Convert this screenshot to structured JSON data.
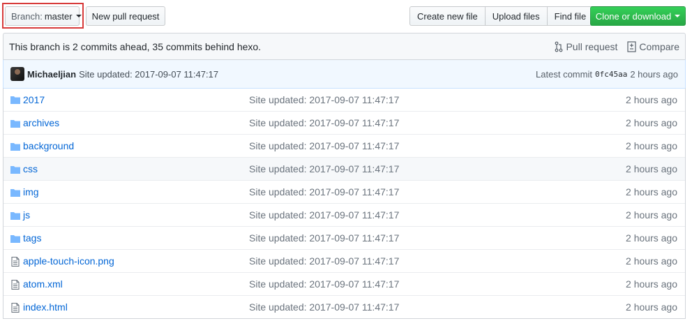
{
  "toolbar": {
    "branch_label": "Branch:",
    "branch_value": "master",
    "new_pull_request": "New pull request",
    "create_new_file": "Create new file",
    "upload_files": "Upload files",
    "find_file": "Find file",
    "clone_or_download": "Clone or download"
  },
  "info": {
    "branch_status": "This branch is 2 commits ahead, 35 commits behind hexo.",
    "pull_request": "Pull request",
    "compare": "Compare"
  },
  "latest_commit": {
    "author": "Michaeljian",
    "message": "Site updated: 2017-09-07 11:47:17",
    "prefix": "Latest commit",
    "sha": "0fc45aa",
    "age": "2 hours ago"
  },
  "files": [
    {
      "type": "folder-icon",
      "name": "2017",
      "message": "Site updated: 2017-09-07 11:47:17",
      "age": "2 hours ago"
    },
    {
      "type": "folder-icon",
      "name": "archives",
      "message": "Site updated: 2017-09-07 11:47:17",
      "age": "2 hours ago"
    },
    {
      "type": "folder-icon",
      "name": "background",
      "message": "Site updated: 2017-09-07 11:47:17",
      "age": "2 hours ago"
    },
    {
      "type": "folder-icon",
      "name": "css",
      "message": "Site updated: 2017-09-07 11:47:17",
      "age": "2 hours ago"
    },
    {
      "type": "folder-icon",
      "name": "img",
      "message": "Site updated: 2017-09-07 11:47:17",
      "age": "2 hours ago"
    },
    {
      "type": "folder-icon",
      "name": "js",
      "message": "Site updated: 2017-09-07 11:47:17",
      "age": "2 hours ago"
    },
    {
      "type": "folder-icon",
      "name": "tags",
      "message": "Site updated: 2017-09-07 11:47:17",
      "age": "2 hours ago"
    },
    {
      "type": "file-icon",
      "name": "apple-touch-icon.png",
      "message": "Site updated: 2017-09-07 11:47:17",
      "age": "2 hours ago"
    },
    {
      "type": "file-icon",
      "name": "atom.xml",
      "message": "Site updated: 2017-09-07 11:47:17",
      "age": "2 hours ago"
    },
    {
      "type": "file-icon",
      "name": "index.html",
      "message": "Site updated: 2017-09-07 11:47:17",
      "age": "2 hours ago"
    }
  ],
  "colors": {
    "link": "#0366d6",
    "muted": "#6a737d",
    "icon": "#79b8ff",
    "clone_green": "#28a745",
    "highlight_red": "#d73a3a"
  }
}
